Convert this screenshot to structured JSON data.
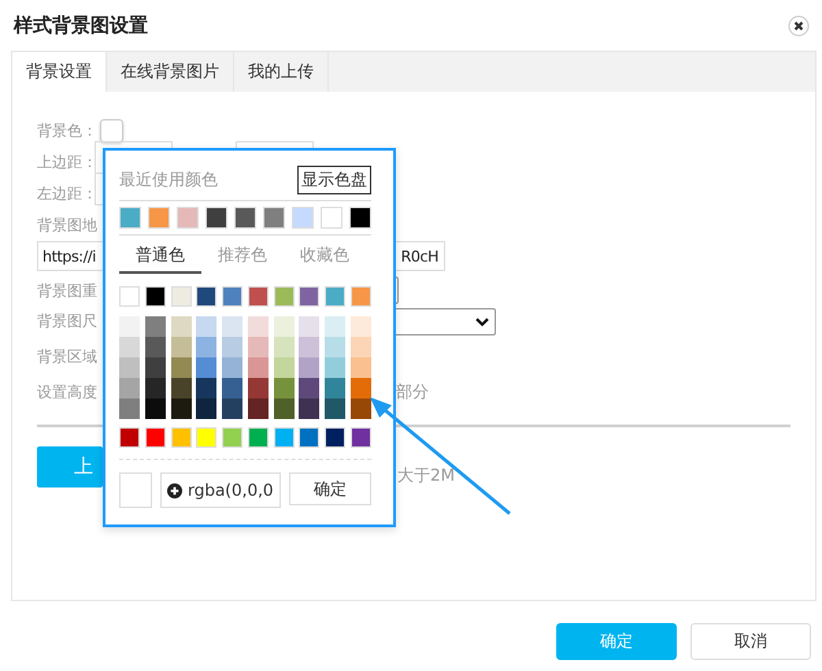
{
  "window": {
    "title": "样式背景图设置"
  },
  "tabs": [
    {
      "label": "背景设置",
      "selected": true
    },
    {
      "label": "在线背景图片",
      "selected": false
    },
    {
      "label": "我的上传",
      "selected": false
    }
  ],
  "form": {
    "background_color": {
      "label": "背景色：",
      "color": "#ffffff"
    },
    "top_margin": {
      "label": "上边距："
    },
    "left_margin": {
      "label": "左边距："
    },
    "image_url": {
      "label": "背景图地",
      "value_start": "https://i",
      "value_end": "R0cH"
    },
    "repeat": {
      "label": "背景图重"
    },
    "size": {
      "label": "背景图尺"
    },
    "area": {
      "label": "背景区域"
    },
    "height_note": {
      "start": "设置高度",
      "end": "部分"
    },
    "upload": {
      "button": "上",
      "hint": "大于2M"
    }
  },
  "color_picker": {
    "recent_title": "最近使用颜色",
    "show_palette_button": "显示色盘",
    "recent": [
      {
        "color": "#4bacc6"
      },
      {
        "color": "#f79646"
      },
      {
        "color": "#e5b9b7"
      },
      {
        "color": "#3f3f3f"
      },
      {
        "color": "#595959"
      },
      {
        "color": "#7f7f7f"
      },
      {
        "color": "#c6d9ff"
      },
      {
        "color": "#ffffff"
      },
      {
        "color": "#000000"
      }
    ],
    "tabs": [
      {
        "label": "普通色",
        "selected": true
      },
      {
        "label": "推荐色",
        "selected": false
      },
      {
        "label": "收藏色",
        "selected": false
      }
    ],
    "theme": [
      {
        "color": "#ffffff"
      },
      {
        "color": "#000000"
      },
      {
        "color": "#eeece1"
      },
      {
        "color": "#1f497d"
      },
      {
        "color": "#4f81bd"
      },
      {
        "color": "#c0504d"
      },
      {
        "color": "#9bbb59"
      },
      {
        "color": "#8064a2"
      },
      {
        "color": "#4bacc6"
      },
      {
        "color": "#f79646"
      }
    ],
    "shades": [
      {
        "colors": [
          {
            "color": "#f2f2f2"
          },
          {
            "color": "#d8d8d8"
          },
          {
            "color": "#bfbfbf"
          },
          {
            "color": "#a5a5a5"
          },
          {
            "color": "#7f7f7f"
          }
        ]
      },
      {
        "colors": [
          {
            "color": "#7f7f7f"
          },
          {
            "color": "#595959"
          },
          {
            "color": "#3f3f3f"
          },
          {
            "color": "#262626"
          },
          {
            "color": "#0c0c0c"
          }
        ]
      },
      {
        "colors": [
          {
            "color": "#ddd9c3"
          },
          {
            "color": "#c4bd97"
          },
          {
            "color": "#938953"
          },
          {
            "color": "#494429"
          },
          {
            "color": "#1d1b10"
          }
        ]
      },
      {
        "colors": [
          {
            "color": "#c6d9f0"
          },
          {
            "color": "#8db3e2"
          },
          {
            "color": "#548dd4"
          },
          {
            "color": "#17365d"
          },
          {
            "color": "#0f243e"
          }
        ]
      },
      {
        "colors": [
          {
            "color": "#dbe5f1"
          },
          {
            "color": "#b8cce4"
          },
          {
            "color": "#95b3d7"
          },
          {
            "color": "#366092"
          },
          {
            "color": "#244061"
          }
        ]
      },
      {
        "colors": [
          {
            "color": "#f2dcdb"
          },
          {
            "color": "#e5b9b7"
          },
          {
            "color": "#d99694"
          },
          {
            "color": "#953734"
          },
          {
            "color": "#632423"
          }
        ]
      },
      {
        "colors": [
          {
            "color": "#ebf1dd"
          },
          {
            "color": "#d7e3bc"
          },
          {
            "color": "#c3d69b"
          },
          {
            "color": "#76923c"
          },
          {
            "color": "#4f6128"
          }
        ]
      },
      {
        "colors": [
          {
            "color": "#e5e0ec"
          },
          {
            "color": "#ccc1d9"
          },
          {
            "color": "#b2a2c7"
          },
          {
            "color": "#5f497a"
          },
          {
            "color": "#3f3151"
          }
        ]
      },
      {
        "colors": [
          {
            "color": "#dbeef3"
          },
          {
            "color": "#b7dde8"
          },
          {
            "color": "#92cddc"
          },
          {
            "color": "#31859b"
          },
          {
            "color": "#205867"
          }
        ]
      },
      {
        "colors": [
          {
            "color": "#fdeada"
          },
          {
            "color": "#fbd5b5"
          },
          {
            "color": "#fac08f"
          },
          {
            "color": "#e36c09"
          },
          {
            "color": "#974806"
          }
        ]
      }
    ],
    "standard": [
      {
        "color": "#c00000"
      },
      {
        "color": "#ff0000"
      },
      {
        "color": "#ffc000"
      },
      {
        "color": "#ffff00"
      },
      {
        "color": "#92d050"
      },
      {
        "color": "#00b050"
      },
      {
        "color": "#00b0f0"
      },
      {
        "color": "#0070c0"
      },
      {
        "color": "#002060"
      },
      {
        "color": "#7030a0"
      }
    ],
    "current_value": "rgba(0,0,0",
    "confirm": "确定"
  },
  "buttons": [
    {
      "label": "确定",
      "kind": "primary"
    },
    {
      "label": "取消",
      "kind": "default"
    }
  ]
}
